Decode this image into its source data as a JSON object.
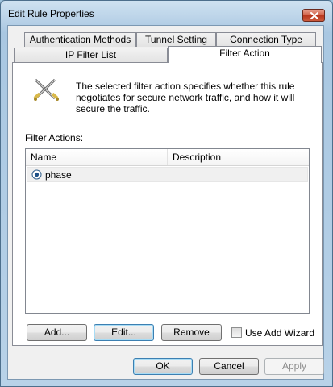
{
  "window": {
    "title": "Edit Rule Properties"
  },
  "tabs": {
    "row1": [
      "Authentication Methods",
      "Tunnel Setting",
      "Connection Type"
    ],
    "row2": [
      "IP Filter List",
      "Filter Action"
    ],
    "active": "Filter Action"
  },
  "panel": {
    "description": "The selected filter action specifies whether this rule negotiates for secure network traffic, and how it will secure the traffic.",
    "filter_actions_label": "Filter Actions:",
    "columns": [
      "Name",
      "Description"
    ],
    "rows": [
      {
        "name": "phase",
        "description": "",
        "selected": true
      }
    ],
    "buttons": {
      "add": "Add...",
      "edit": "Edit...",
      "remove": "Remove"
    },
    "wizard": {
      "label": "Use Add Wizard",
      "checked": false
    }
  },
  "footer": {
    "ok": "OK",
    "cancel": "Cancel",
    "apply": "Apply"
  },
  "icons": {
    "close": "close-icon",
    "rule": "crossed-swords-icon",
    "radio": "radio-selected-icon"
  }
}
